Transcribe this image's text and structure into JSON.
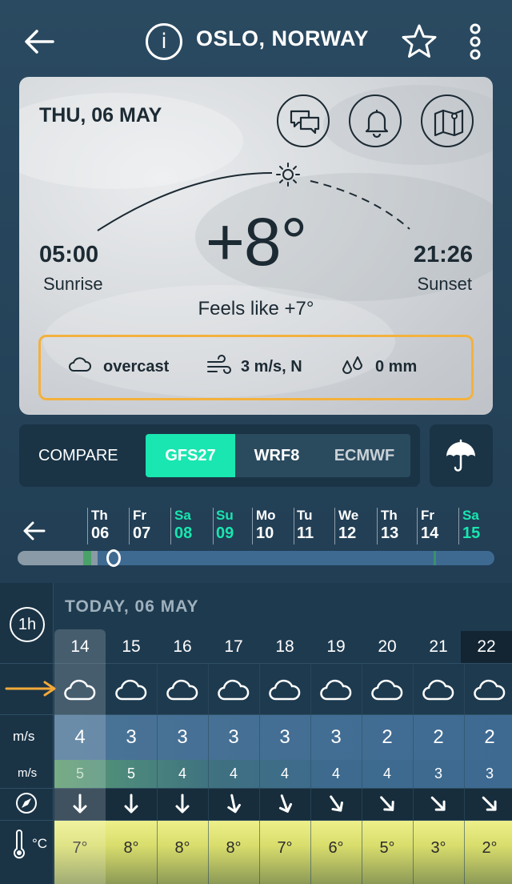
{
  "header": {
    "city": "OSLO, NORWAY",
    "info_icon": "i"
  },
  "card": {
    "date": "THU, 06 MAY",
    "temperature": "+8°",
    "feels_like": "Feels like +7°",
    "sunrise": {
      "time": "05:00",
      "label": "Sunrise"
    },
    "sunset": {
      "time": "21:26",
      "label": "Sunset"
    },
    "summary": {
      "condition": "overcast",
      "wind": "3 m/s, N",
      "precip": "0 mm"
    }
  },
  "compare": {
    "label": "COMPARE",
    "models": [
      "GFS27",
      "WRF8",
      "ECMWF"
    ],
    "active_model": "GFS27"
  },
  "days": [
    {
      "name": "Th",
      "date": "06",
      "weekend": false
    },
    {
      "name": "Fr",
      "date": "07",
      "weekend": false
    },
    {
      "name": "Sa",
      "date": "08",
      "weekend": true
    },
    {
      "name": "Su",
      "date": "09",
      "weekend": true
    },
    {
      "name": "Mo",
      "date": "10",
      "weekend": false
    },
    {
      "name": "Tu",
      "date": "11",
      "weekend": false
    },
    {
      "name": "We",
      "date": "12",
      "weekend": false
    },
    {
      "name": "Th",
      "date": "13",
      "weekend": false
    },
    {
      "name": "Fr",
      "date": "14",
      "weekend": false
    },
    {
      "name": "Sa",
      "date": "15",
      "weekend": true
    }
  ],
  "forecast": {
    "interval_label": "1h",
    "today_label": "TODAY, 06 MAY",
    "units": {
      "wind": "m/s",
      "gust": "m/s",
      "temp": "°C"
    },
    "hours": [
      "14",
      "15",
      "16",
      "17",
      "18",
      "19",
      "20",
      "21",
      "22"
    ],
    "wind": [
      "4",
      "3",
      "3",
      "3",
      "3",
      "3",
      "2",
      "2",
      "2"
    ],
    "gust": [
      "5",
      "5",
      "4",
      "4",
      "4",
      "4",
      "4",
      "3",
      "3"
    ],
    "wind_dir_icons": [
      "arrow-down-icon",
      "arrow-down-icon",
      "arrow-down-icon",
      "arrow-down-icon",
      "arrow-down-icon",
      "arrow-down-right-icon",
      "arrow-down-right-icon",
      "arrow-down-right-icon",
      "arrow-down-right-icon"
    ],
    "temps": [
      "7°",
      "8°",
      "8°",
      "8°",
      "7°",
      "6°",
      "5°",
      "3°",
      "2°"
    ]
  },
  "colors": {
    "accent": "#19e6b0",
    "highlight_border": "#f3b13e",
    "temp_band": "#e6e67a"
  }
}
